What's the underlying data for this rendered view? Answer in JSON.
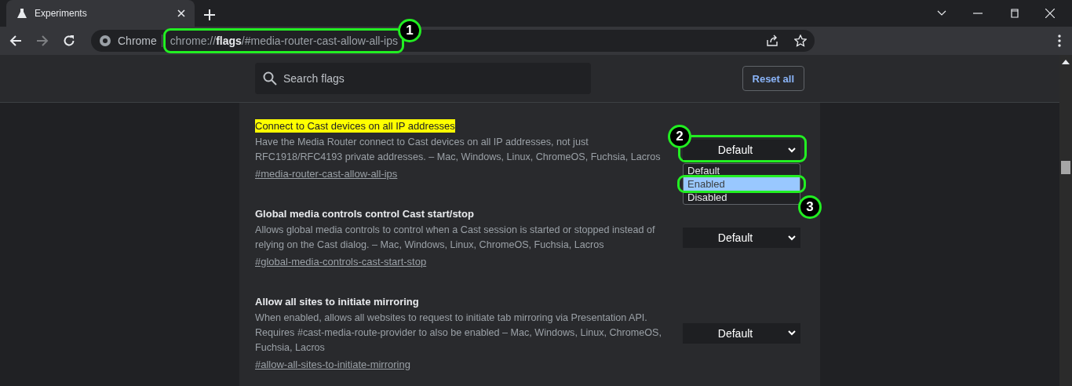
{
  "tabs": [
    {
      "title": "Experiments",
      "selected": true
    }
  ],
  "address": {
    "origin_label": "Chrome",
    "url_scheme": "chrome://",
    "url_host": "flags",
    "url_rest": "/#media-router-cast-allow-all-ips",
    "callout": "1"
  },
  "search": {
    "placeholder": "Search flags"
  },
  "reset_button": "Reset all",
  "flags": [
    {
      "title": "Connect to Cast devices on all IP addresses",
      "highlighted": true,
      "description": "Have the Media Router connect to Cast devices on all IP addresses, not just RFC1918/RFC4193 private addresses. – Mac, Windows, Linux, ChromeOS, Fuchsia, Lacros",
      "link": "#media-router-cast-allow-all-ips",
      "select": {
        "value": "Default",
        "callout": "2",
        "options": [
          {
            "label": "Default",
            "highlighted": false
          },
          {
            "label": "Enabled",
            "highlighted": true,
            "callout": "3"
          },
          {
            "label": "Disabled",
            "highlighted": false
          }
        ]
      }
    },
    {
      "title": "Global media controls control Cast start/stop",
      "highlighted": false,
      "description": "Allows global media controls to control when a Cast session is started or stopped instead of relying on the Cast dialog. – Mac, Windows, Linux, ChromeOS, Fuchsia, Lacros",
      "link": "#global-media-controls-cast-start-stop",
      "select": {
        "value": "Default"
      }
    },
    {
      "title": "Allow all sites to initiate mirroring",
      "highlighted": false,
      "description": "When enabled, allows all websites to request to initiate tab mirroring via Presentation API. Requires #cast-media-route-provider to also be enabled – Mac, Windows, Linux, ChromeOS, Fuchsia, Lacros",
      "link": "#allow-all-sites-to-initiate-mirroring",
      "select": {
        "value": "Default"
      }
    }
  ]
}
